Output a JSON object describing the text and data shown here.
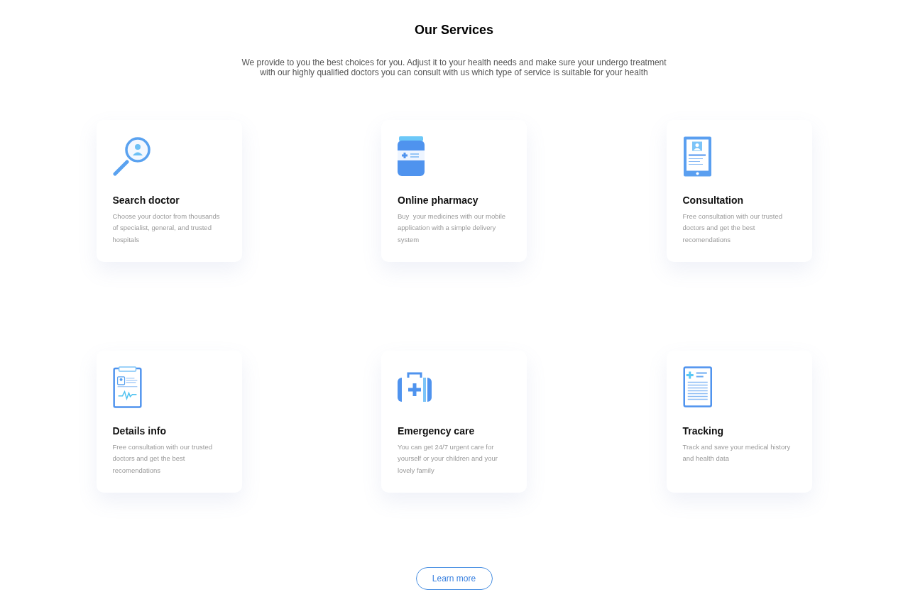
{
  "section": {
    "title": "Our Services",
    "subtitle": "We provide to you the best choices for you. Adjust it to your health needs and make sure your undergo treatment with our highly qualified doctors you can consult with us which type of service is suitable for your health"
  },
  "services": [
    {
      "title": "Search doctor",
      "description": "Choose your doctor from thousands of specialist, general, and trusted hospitals"
    },
    {
      "title": "Online pharmacy",
      "description": "Buy  your medicines with our mobile application with a simple delivery system"
    },
    {
      "title": "Consultation",
      "description": "Free consultation with our trusted doctors and get the best recomendations"
    },
    {
      "title": "Details info",
      "description": "Free consultation with our trusted doctors and get the best recomendations"
    },
    {
      "title": "Emergency care",
      "description": "You can get 24/7 urgent care for yourself or your children and your lovely family"
    },
    {
      "title": "Tracking",
      "description": "Track and save your medical history and health data"
    }
  ],
  "button": {
    "label": "Learn more"
  }
}
